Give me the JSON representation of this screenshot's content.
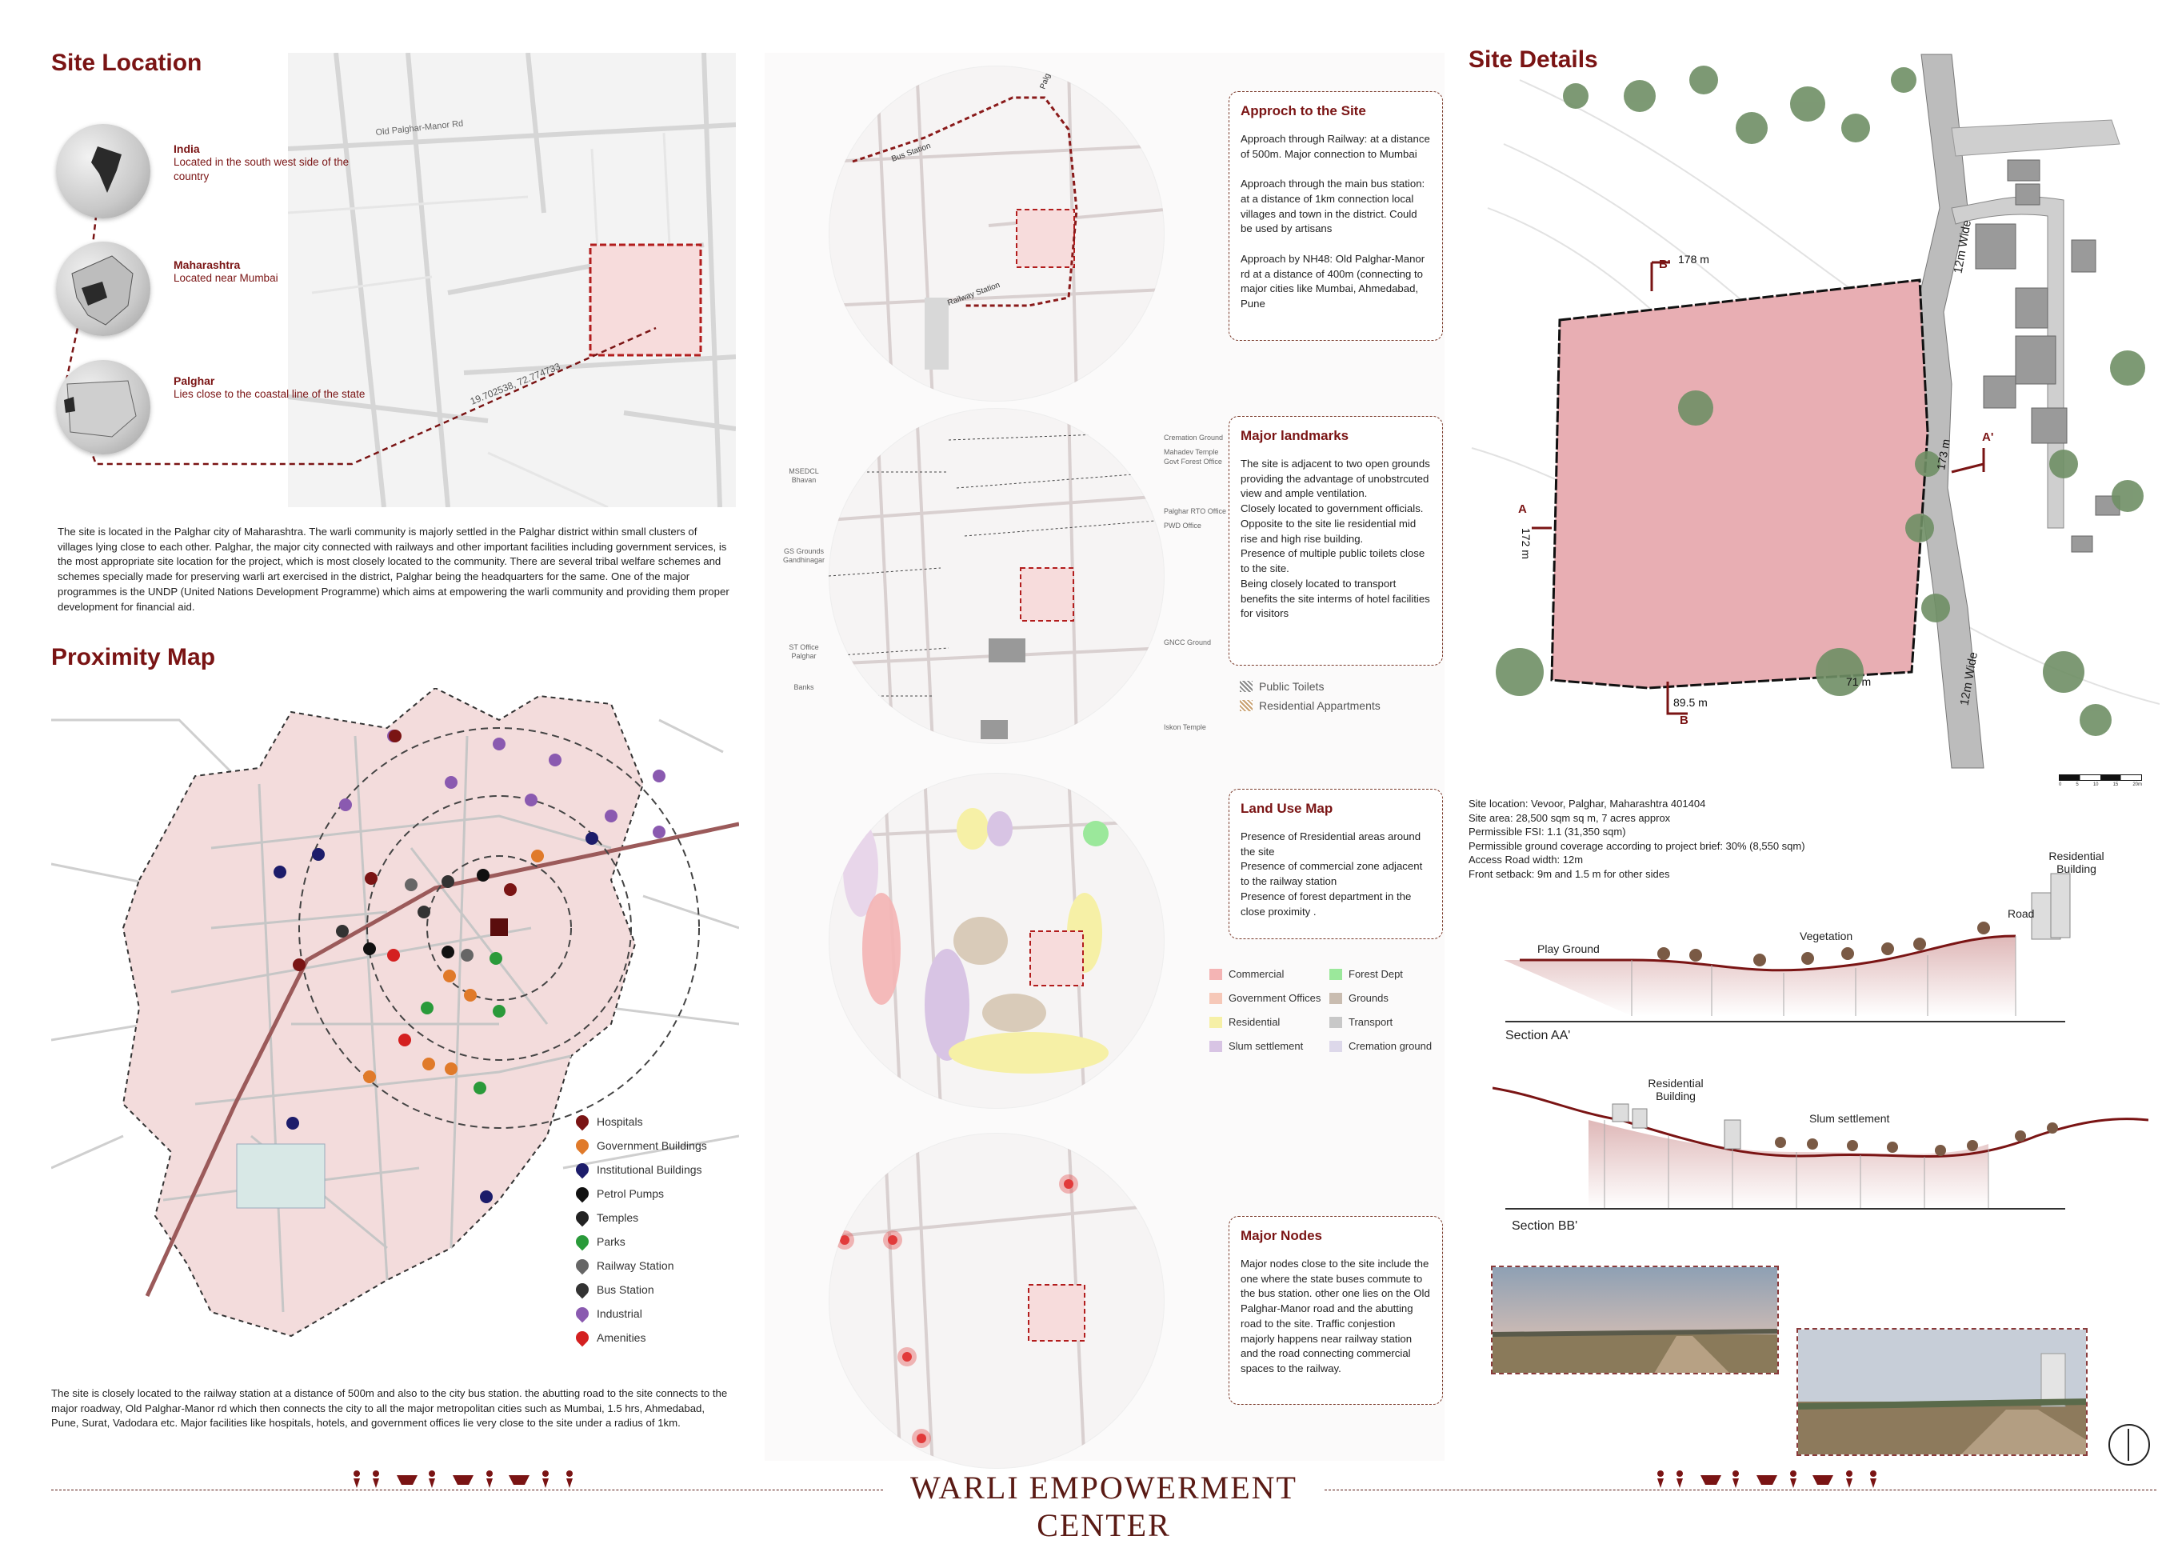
{
  "site_location": {
    "title": "Site Location",
    "levels": [
      {
        "name": "India",
        "desc": "Located in the south west side of the country"
      },
      {
        "name": "Maharashtra",
        "desc": "Located near Mumbai"
      },
      {
        "name": "Palghar",
        "desc": "Lies close to the coastal line of the state"
      }
    ],
    "road_label": "Old Palghar-Manor Rd",
    "coord_label": "19.702538, 72.774733",
    "paragraph": "The site is located in the Palghar city of Maharashtra. The warli community is majorly settled in the Palghar district within small clusters of villages lying close to each other. Palghar, the major city connected with railways and other important facilities including government services, is the most appropriate site location for the project, which is most closely located to the community. There are several tribal welfare schemes and schemes specially made for preserving warli art exercised in the district, Palghar being the headquarters for the same. One of the major programmes is the UNDP (United Nations Development Programme) which aims at empowering the warli community and providing them proper development for financial aid."
  },
  "proximity": {
    "title": "Proximity Map",
    "legend": [
      {
        "label": "Hospitals",
        "color": "#7a1414"
      },
      {
        "label": "Government Buildings",
        "color": "#e07a2a"
      },
      {
        "label": "Institutional Buildings",
        "color": "#1c1c6a"
      },
      {
        "label": "Petrol Pumps",
        "color": "#111111"
      },
      {
        "label": "Temples",
        "color": "#222222"
      },
      {
        "label": "Parks",
        "color": "#2a9a3a"
      },
      {
        "label": "Railway Station",
        "color": "#666666"
      },
      {
        "label": "Bus Station",
        "color": "#333333"
      },
      {
        "label": "Industrial",
        "color": "#8a5ab0"
      },
      {
        "label": "Amenities",
        "color": "#d42020"
      }
    ],
    "paragraph": "The site is closely located to the railway station at a distance of 500m and also to the city bus station. the abutting road to the site connects to the major roadway, Old Palghar-Manor rd which then connects the city to all the major metropolitan cities such as Mumbai, 1.5 hrs, Ahmedabad, Pune, Surat, Vadodara etc. Major facilities like hospitals, hotels, and government offices lie very close to the site under a radius of 1km."
  },
  "approach": {
    "title": "Approch to the Site",
    "body": "Approach through Railway: at a distance of 500m. Major connection to Mumbai\n\nApproach through the main bus station: at a distance of 1km connection local villages and town in the district. Could be used by artisans\n\nApproach by NH48: Old Palghar-Manor rd at a distance of 400m (connecting to major cities like Mumbai, Ahmedabad, Pune",
    "map_labels": [
      "Palghar -Manor Highway",
      "Bus Station",
      "Railway Station"
    ]
  },
  "landmarks": {
    "title": "Major landmarks",
    "body": "The site is adjacent to two open grounds providing the advantage of unobstrcuted view and ample ventilation.\nClosely located to government officials.\nOpposite to the site lie residential mid rise and high rise building.\nPresence of multiple public toilets close to the site.\nBeing closely located to transport benefits the site interms of hotel facilities for visitors",
    "legend": [
      "Public Toilets",
      "Residential Appartments"
    ],
    "map_labels_right": [
      "Cremation Ground",
      "Mahadev Temple",
      "Govt Forest Office",
      "Palghar RTO Office",
      "PWD Office",
      "GNCC Ground",
      "Iskon Temple"
    ],
    "map_labels_left": [
      "MSEDCL Bhavan",
      "GS Grounds Gandhinagar",
      "ST Office Palghar",
      "Banks"
    ]
  },
  "landuse": {
    "title": "Land Use Map",
    "body": "Presence of Rresidential areas around the site\nPresence of commercial zone adjacent to the railway station\nPresence of forest department in the close proximity .",
    "legend": [
      {
        "label": "Commercial",
        "color": "#f4b4b4"
      },
      {
        "label": "Forest Dept",
        "color": "#9be89b"
      },
      {
        "label": "Government Offices",
        "color": "#f6c8b8"
      },
      {
        "label": "Grounds",
        "color": "#c9bcb0"
      },
      {
        "label": "Residential",
        "color": "#f6f0a6"
      },
      {
        "label": "Transport",
        "color": "#c8c8c8"
      },
      {
        "label": "Slum settlement",
        "color": "#d8c4e4"
      },
      {
        "label": "Cremation ground",
        "color": "#ddd8ea"
      }
    ]
  },
  "nodes": {
    "title": "Major Nodes",
    "body": "Major nodes close to the site include the one where the state buses commute to the bus station. other one lies on the Old Palghar-Manor road and the abutting road to the site. Traffic conjestion majorly happens near railway station and the road connecting commercial spaces to the railway."
  },
  "site_details": {
    "title": "Site Details",
    "dims": {
      "top": "178 m",
      "left": "172 m",
      "right": "173 m",
      "bottom_left": "89.5 m",
      "bottom_right": "71 m"
    },
    "road_labels": [
      "12m Wide",
      "12m Wide"
    ],
    "section_marks": {
      "a": "A",
      "a2": "A'",
      "b": "B",
      "b2": "B'"
    },
    "scale_labels": [
      "0",
      "5",
      "10",
      "15",
      "20m"
    ],
    "info": [
      "Site location: Vevoor, Palghar, Maharashtra 401404",
      "Site area: 28,500 sqm sq m, 7 acres approx",
      "Permissible FSI: 1.1 (31,350 sqm)",
      "Permissible ground coverage according to project brief: 30% (8,550 sqm)",
      "Access Road width: 12m",
      "Front setback: 9m and 1.5 m for other sides"
    ],
    "section_aa": {
      "title": "Section AA'",
      "labels": [
        "Play Ground",
        "Vegetation",
        "Road",
        "Residential Building"
      ]
    },
    "section_bb": {
      "title": "Section BB'",
      "labels": [
        "Residential Building",
        "Slum settlement"
      ]
    }
  },
  "footer": {
    "title": "WARLI EMPOWERMENT CENTER"
  }
}
